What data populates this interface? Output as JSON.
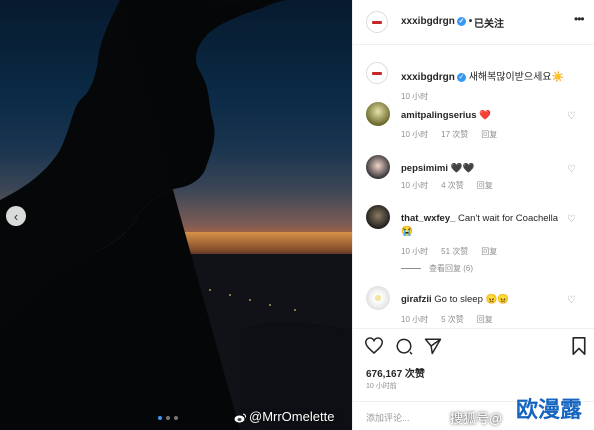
{
  "post": {
    "username": "xxxibgdrgn",
    "follow_label": "已关注",
    "more_label": "•••"
  },
  "caption": {
    "username": "xxxibgdrgn",
    "text": "새해복많이받으세요☀️",
    "time": "10 小时"
  },
  "comments": [
    {
      "username": "amitpalingserius",
      "text": "❤️",
      "time": "10 小时",
      "likes": "17 次赞",
      "reply": "回复"
    },
    {
      "username": "pepsimimi",
      "text": "🖤🖤",
      "time": "10 小时",
      "likes": "4 次赞",
      "reply": "回复"
    },
    {
      "username": "that_wxfey_",
      "text": "Can't wait for Coachella 😭",
      "time": "10 小时",
      "likes": "51 次赞",
      "reply": "回复",
      "view_replies": "查看回复 (6)"
    },
    {
      "username": "girafzii",
      "text": "Go to sleep 😠😠",
      "time": "10 小时",
      "likes": "5 次赞",
      "reply": "回复"
    }
  ],
  "engagement": {
    "likes": "676,167 次赞",
    "time": "10 小时前"
  },
  "add_comment_placeholder": "添加评论...",
  "watermarks": {
    "weibo": "@MrrOmelette",
    "sohu": "搜狐号@",
    "brand": "欧漫露"
  },
  "icons": {
    "left_arrow": "chevron-left-icon",
    "verified": "verified-badge-icon",
    "heart": "heart-icon",
    "comment": "comment-icon",
    "share": "share-icon",
    "bookmark": "bookmark-icon"
  }
}
